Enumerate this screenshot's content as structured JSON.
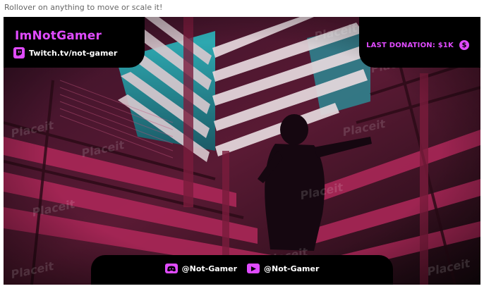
{
  "page": {
    "hint": "Rollover on anything to move or scale it!"
  },
  "overlay": {
    "channel_name": "ImNotGamer",
    "channel_url": "Twitch.tv/not-gamer",
    "donation": "LAST DONATION: $1K",
    "donation_icon": "$",
    "socials": [
      {
        "icon": "discord-icon",
        "handle": "@Not-Gamer"
      },
      {
        "icon": "youtube-icon",
        "handle": "@Not-Gamer"
      }
    ],
    "watermark": "Placeit"
  },
  "colors": {
    "accent": "#e04bff",
    "panel": "#000000",
    "text": "#ffffff"
  }
}
